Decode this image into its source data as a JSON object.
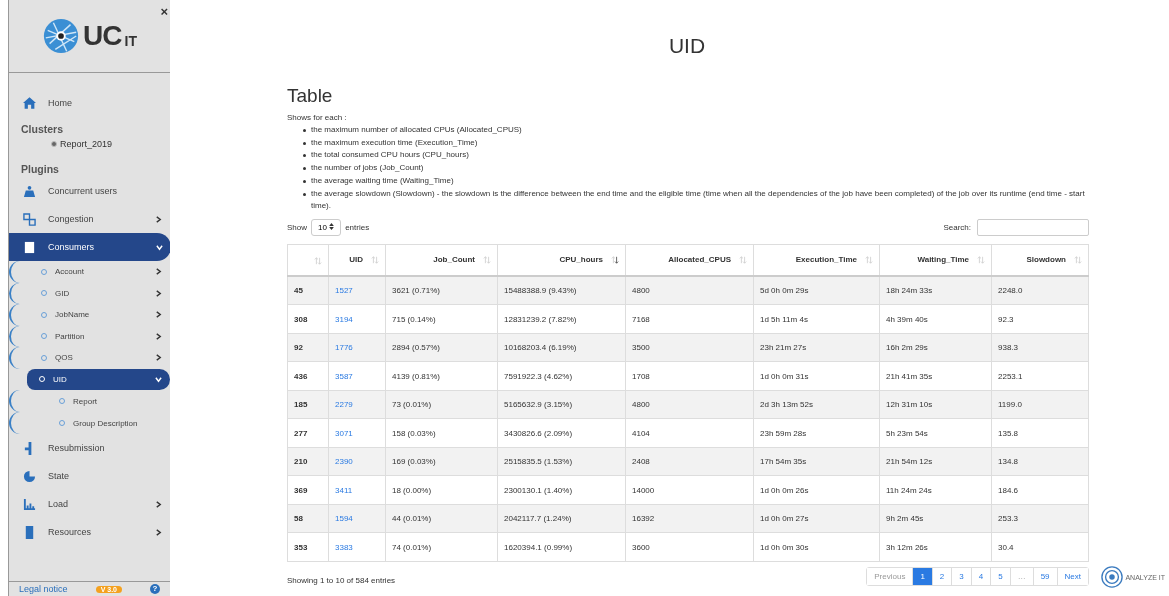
{
  "sidebar": {
    "close": "×",
    "logo": {
      "main": "UC",
      "suffix": "IT"
    },
    "home": {
      "label": "Home"
    },
    "clusters": {
      "heading": "Clusters",
      "items": [
        {
          "label": "Report_2019",
          "selected": true
        }
      ]
    },
    "plugins": {
      "heading": "Plugins",
      "items": [
        {
          "label": "Concurrent users",
          "has_children": false,
          "selected": false
        },
        {
          "label": "Congestion",
          "has_children": true,
          "expanded": false,
          "selected": false
        },
        {
          "label": "Consumers",
          "has_children": true,
          "expanded": true,
          "selected": true,
          "children": [
            {
              "label": "Account",
              "has_children": true,
              "expanded": false,
              "selected": false
            },
            {
              "label": "GID",
              "has_children": true,
              "expanded": false,
              "selected": false
            },
            {
              "label": "JobName",
              "has_children": true,
              "expanded": false,
              "selected": false
            },
            {
              "label": "Partition",
              "has_children": true,
              "expanded": false,
              "selected": false
            },
            {
              "label": "QOS",
              "has_children": true,
              "expanded": false,
              "selected": false
            },
            {
              "label": "UID",
              "has_children": true,
              "expanded": true,
              "selected": true,
              "children": [
                {
                  "label": "Report",
                  "selected": false
                },
                {
                  "label": "Group Description",
                  "selected": false
                }
              ]
            }
          ]
        },
        {
          "label": "Resubmission",
          "has_children": false,
          "selected": false
        },
        {
          "label": "State",
          "has_children": false,
          "selected": false
        },
        {
          "label": "Load",
          "has_children": true,
          "expanded": false,
          "selected": false
        },
        {
          "label": "Resources",
          "has_children": true,
          "expanded": false,
          "selected": false
        }
      ]
    },
    "footer": {
      "legal": "Legal notice",
      "version": "V 3.0",
      "help": "?"
    }
  },
  "page_title": "UID",
  "section": {
    "title": "Table",
    "intro": "Shows for each :",
    "bullets": [
      "the maximum number of allocated CPUs (Allocated_CPUS)",
      "the maximum execution time (Execution_Time)",
      "the total consumed CPU hours (CPU_hours)",
      "the number of jobs (Job_Count)",
      "the average waiting time (Waiting_Time)",
      "the average slowdown (Slowdown) - the slowdown is the difference between the end time and the eligible time (time when all the dependencies of the job have been completed) of the job over its runtime (end time - start time)."
    ]
  },
  "length": {
    "before": "Show",
    "value": "10",
    "after": "entries"
  },
  "search": {
    "label": "Search:"
  },
  "table": {
    "columns": [
      {
        "sorted": false
      },
      {
        "label": "UID",
        "sorted": false
      },
      {
        "label": "Job_Count",
        "sorted": false
      },
      {
        "label": "CPU_hours",
        "sorted": true
      },
      {
        "label": "Allocated_CPUS",
        "sorted": false
      },
      {
        "label": "Execution_Time",
        "sorted": false
      },
      {
        "label": "Waiting_Time",
        "sorted": false
      },
      {
        "label": "Slowdown",
        "sorted": false
      }
    ],
    "rows": [
      [
        "45",
        "1527",
        "3621 (0.71%)",
        "15488388.9 (9.43%)",
        "4800",
        "5d 0h 0m 29s",
        "18h 24m 33s",
        "2248.0"
      ],
      [
        "308",
        "3194",
        "715 (0.14%)",
        "12831239.2 (7.82%)",
        "7168",
        "1d 5h 11m 4s",
        "4h 39m 40s",
        "92.3"
      ],
      [
        "92",
        "1776",
        "2894 (0.57%)",
        "10168203.4 (6.19%)",
        "3500",
        "23h 21m 27s",
        "16h 2m 29s",
        "938.3"
      ],
      [
        "436",
        "3587",
        "4139 (0.81%)",
        "7591922.3 (4.62%)",
        "1708",
        "1d 0h 0m 31s",
        "21h 41m 35s",
        "2253.1"
      ],
      [
        "185",
        "2279",
        "73 (0.01%)",
        "5165632.9 (3.15%)",
        "4800",
        "2d 3h 13m 52s",
        "12h 31m 10s",
        "1199.0"
      ],
      [
        "277",
        "3071",
        "158 (0.03%)",
        "3430826.6 (2.09%)",
        "4104",
        "23h 59m 28s",
        "5h 23m 54s",
        "135.8"
      ],
      [
        "210",
        "2390",
        "169 (0.03%)",
        "2515835.5 (1.53%)",
        "2408",
        "17h 54m 35s",
        "21h 54m 12s",
        "134.8"
      ],
      [
        "369",
        "3411",
        "18 (0.00%)",
        "2300130.1 (1.40%)",
        "14000",
        "1d 0h 0m 26s",
        "11h 24m 24s",
        "184.6"
      ],
      [
        "58",
        "1594",
        "44 (0.01%)",
        "2042117.7 (1.24%)",
        "16392",
        "1d 0h 0m 27s",
        "9h 2m 45s",
        "253.3"
      ],
      [
        "353",
        "3383",
        "74 (0.01%)",
        "1620394.1 (0.99%)",
        "3600",
        "1d 0h 0m 30s",
        "3h 12m 26s",
        "30.4"
      ]
    ]
  },
  "info": "Showing 1 to 10 of 584 entries",
  "pagination": [
    {
      "label": "Previous",
      "selected": false,
      "disabled": true
    },
    {
      "label": "1",
      "selected": true,
      "disabled": false
    },
    {
      "label": "2",
      "selected": false,
      "disabled": false
    },
    {
      "label": "3",
      "selected": false,
      "disabled": false
    },
    {
      "label": "4",
      "selected": false,
      "disabled": false
    },
    {
      "label": "5",
      "selected": false,
      "disabled": false
    },
    {
      "label": "…",
      "selected": false,
      "disabled": true
    },
    {
      "label": "59",
      "selected": false,
      "disabled": false
    },
    {
      "label": "Next",
      "selected": false,
      "disabled": false
    }
  ],
  "brand": {
    "label": "ANALYZE IT"
  }
}
